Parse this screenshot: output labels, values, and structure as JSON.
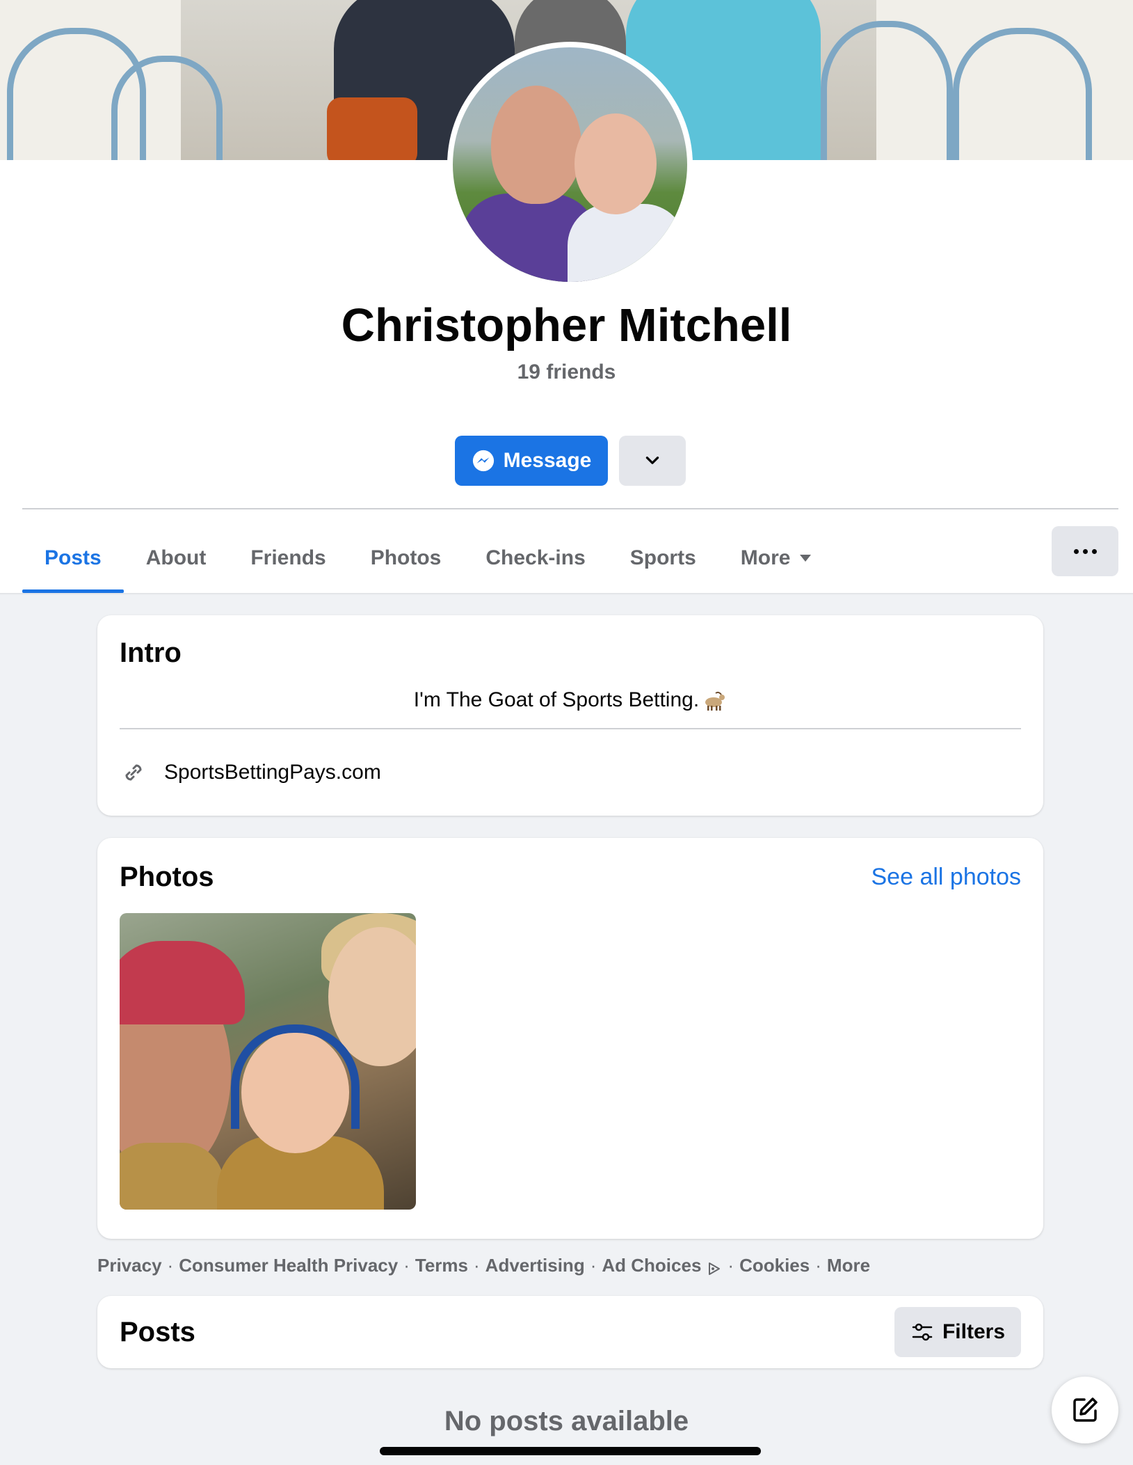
{
  "profile": {
    "name": "Christopher Mitchell",
    "friends": "19 friends",
    "message_label": "Message"
  },
  "tabs": [
    {
      "label": "Posts",
      "active": true
    },
    {
      "label": "About"
    },
    {
      "label": "Friends"
    },
    {
      "label": "Photos"
    },
    {
      "label": "Check-ins"
    },
    {
      "label": "Sports"
    },
    {
      "label": "More"
    }
  ],
  "intro": {
    "title": "Intro",
    "bio": "I'm The Goat of Sports Betting.",
    "bio_emoji": "goat",
    "website": "SportsBettingPays.com"
  },
  "photos": {
    "title": "Photos",
    "see_all": "See all photos"
  },
  "footer": {
    "links": [
      "Privacy",
      "Consumer Health Privacy",
      "Terms",
      "Advertising",
      "Ad Choices",
      "Cookies",
      "More"
    ],
    "separator": "·"
  },
  "posts": {
    "title": "Posts",
    "filters_label": "Filters",
    "empty_text": "No posts available"
  },
  "icons": {
    "message": "messenger-icon",
    "dropdown": "chevron-down-icon",
    "more_caret": "caret-down-icon",
    "overflow": "more-dots-icon",
    "link": "link-icon",
    "ad_choices": "ad-choices-icon",
    "filters": "filters-icon",
    "compose": "compose-icon"
  },
  "colors": {
    "accent": "#1b74e4",
    "page_bg": "#f0f2f5",
    "secondary_text": "#65676b",
    "button_gray": "#e4e6eb"
  }
}
